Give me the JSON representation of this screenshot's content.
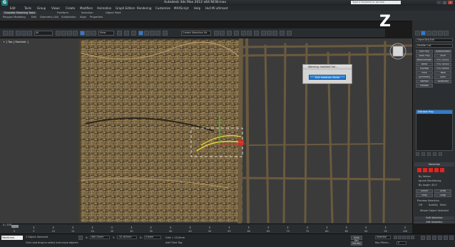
{
  "window": {
    "title": "Autodesk 3ds Max 2012 x64      NCW.max",
    "search_placeholder": "Type a keyword or phrase",
    "controls": [
      "–",
      "□",
      "✕"
    ]
  },
  "menu": [
    "Edit",
    "Tools",
    "Group",
    "Views",
    "Create",
    "Modifiers",
    "Animation",
    "Graph Editors",
    "Rendering",
    "Customize",
    "MAXScript",
    "Help",
    "Hull Mi ultimant"
  ],
  "ribbon": {
    "tabs": [
      "Graphite Modeling Tools",
      "Freeform",
      "Selection",
      "Object Paint"
    ],
    "subtabs": [
      "Polygon Modeling",
      "Edit",
      "Geometry (All)",
      "Subdivision",
      "Align",
      "Properties"
    ]
  },
  "toolbar": {
    "selection_filter": "All",
    "view_dropdown": "View",
    "named_selection": "Create Selection Se"
  },
  "viewport": {
    "label": "+ ] Top ] Realistic ]",
    "brand_glyph": "Z"
  },
  "dialog": {
    "title": "Warning: Isolated Sel...",
    "button": "Exit Isolation Mode"
  },
  "command_panel": {
    "object_name": "Object184(Edit",
    "modifier_list": "Modifier List",
    "buttons": [
      [
        "Edit Poly",
        "TurboSmooth"
      ],
      [
        "Shell Poly",
        "Slice"
      ],
      [
        "MeshSmooth",
        "FFD 2x2x2"
      ],
      [
        "Bend",
        "FFD 3x3x3"
      ],
      [
        "Uv/Map",
        "FFD 4x4x4"
      ],
      [
        "Push",
        "Twist"
      ],
      [
        "Symmetry",
        "Shell"
      ],
      [
        "Normal",
        "TurboSmo"
      ],
      [
        "Smooth",
        ""
      ]
    ],
    "stack_item": "Editable Poly",
    "selection_header": "Selection",
    "options": [
      "By Vertex",
      "Ignore Backfacing",
      "By Angle: 45.0",
      "Shrink",
      "Grow",
      "Ring",
      "Loop"
    ],
    "preview_selection": "Preview Selection",
    "preview_options": [
      "Off",
      "SubObj",
      "Multi"
    ],
    "whole_object": "Whole Object Selected",
    "soft_selection": "Soft Selection",
    "edit_geometry": "Edit Geometry"
  },
  "timeline": {
    "frame_display": "0 / 100",
    "ticks": [
      "0",
      "5",
      "10",
      "15",
      "20",
      "25",
      "30",
      "35",
      "40",
      "45",
      "50",
      "55",
      "60",
      "65",
      "70",
      "75",
      "80",
      "85",
      "90",
      "95",
      "100"
    ]
  },
  "status": {
    "script_label": "MaxScript.",
    "selected": "1 Object Selected",
    "prompt": "Click and drag to select and move objects",
    "x_label": "X:",
    "x_value": "465.23mm",
    "y_label": "Y:",
    "y_value": "-32.187mm",
    "z_label": "Z:",
    "z_value": "0.0mm",
    "grid": "Grid = 10.0mm",
    "autokey": "Auto Key",
    "setkey": "Set Key",
    "selected_dropdown": "Selected",
    "key_filters": "Key Filters...",
    "add_time_tag": "Add Time Tag",
    "frame": "0"
  },
  "colors": {
    "accent_blue": "#2f7bd0",
    "viewport_bg": "#3b3b3b",
    "straw": "#8a7449",
    "wood": "#6a5a3e",
    "selection_yellow": "#e8d23a",
    "gizmo_red": "#e0241e",
    "gizmo_green": "#2fcf2f"
  }
}
